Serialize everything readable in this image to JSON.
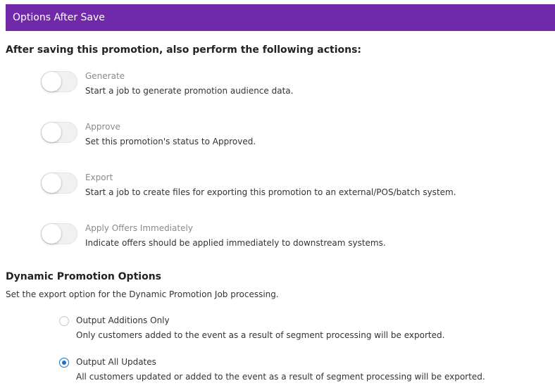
{
  "panel": {
    "title": "Options After Save",
    "accent_color": "#7029a8"
  },
  "after_save": {
    "heading": "After saving this promotion, also perform the following actions:",
    "toggles": [
      {
        "label": "Generate",
        "description": "Start a job to generate promotion audience data.",
        "on": false
      },
      {
        "label": "Approve",
        "description": "Set this promotion's status to Approved.",
        "on": false
      },
      {
        "label": "Export",
        "description": "Start a job to create files for exporting this promotion to an external/POS/batch system.",
        "on": false
      },
      {
        "label": "Apply Offers Immediately",
        "description": "Indicate offers should be applied immediately to downstream systems.",
        "on": false
      }
    ]
  },
  "dynamic": {
    "heading": "Dynamic Promotion Options",
    "description": "Set the export option for the Dynamic Promotion Job processing.",
    "options": [
      {
        "label": "Output Additions Only",
        "description": "Only customers added to the event as a result of segment processing will be exported.",
        "selected": false
      },
      {
        "label": "Output All Updates",
        "description": "All customers updated or added to the event as a result of segment processing will be exported.",
        "selected": true
      }
    ],
    "radio_color": "#1673d6"
  }
}
